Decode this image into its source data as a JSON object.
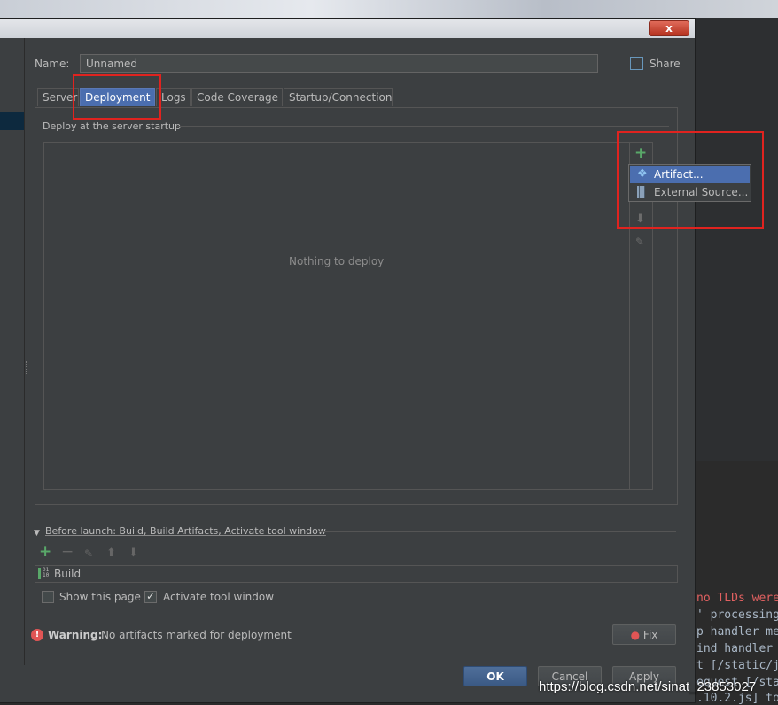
{
  "window": {
    "close_label": "x"
  },
  "name_label": "Name:",
  "name_value": "Unnamed",
  "share_label": "Share",
  "tabs": [
    {
      "label": "Server"
    },
    {
      "label": "Deployment"
    },
    {
      "label": "Logs"
    },
    {
      "label": "Code Coverage"
    },
    {
      "label": "Startup/Connection"
    }
  ],
  "deploy_section_label": "Deploy at the server startup",
  "empty_text": "Nothing to deploy",
  "add_menu": [
    {
      "label": "Artifact...",
      "icon": "artifact-icon"
    },
    {
      "label": "External Source...",
      "icon": "external-source-icon"
    }
  ],
  "before_launch": {
    "label": "Before launch: Build, Build Artifacts, Activate tool window",
    "tasks": [
      {
        "label": "Build",
        "icon": "build-icon"
      }
    ],
    "show_this_page": {
      "label": "Show this page",
      "checked": false
    },
    "activate_tool_window": {
      "label": "Activate tool window",
      "checked": true
    }
  },
  "warning": {
    "bold": "Warning:",
    "text": "No artifacts marked for deployment",
    "fix_label": "Fix"
  },
  "buttons": {
    "ok": "OK",
    "cancel": "Cancel",
    "apply": "Apply"
  },
  "console_lines": [
    "no TLDs were",
    "' processing",
    "p handler me",
    "ind handler",
    "t [/static/j",
    "equest [/sta",
    ".10.2.js] to"
  ],
  "watermark": "https://blog.csdn.net/sinat_23853027",
  "colors": {
    "accent": "#4b6eaf",
    "add_green": "#59a869",
    "warning_red": "#e05555",
    "highlight_red": "#e0231f"
  }
}
